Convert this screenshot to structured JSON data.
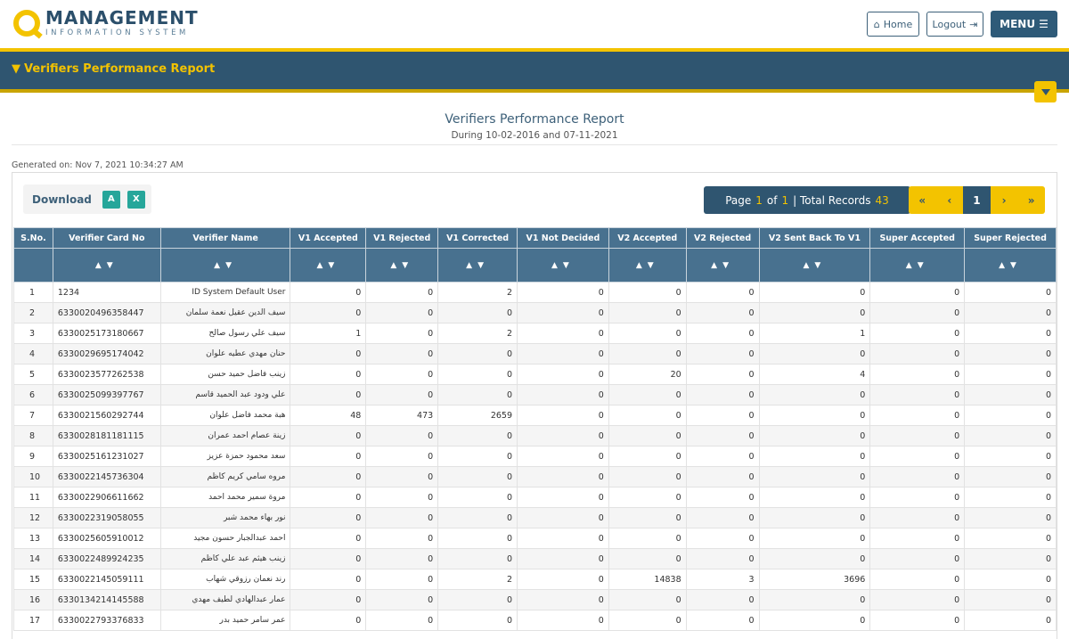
{
  "header": {
    "logo_title": "MANAGEMENT",
    "logo_sub": "INFORMATION SYSTEM",
    "home_label": "Home",
    "logout_label": "Logout",
    "menu_label": "MENU"
  },
  "band": {
    "title": "Verifiers Performance Report"
  },
  "report": {
    "title": "Verifiers Performance Report",
    "subtitle": "During 10-02-2016 and 07-11-2021",
    "generated": "Generated on: Nov 7, 2021 10:34:27 AM"
  },
  "toolbar": {
    "download_label": "Download",
    "pdf_icon_text": "A",
    "excel_icon_text": "X"
  },
  "pagination": {
    "page_label": "Page",
    "current": "1",
    "of_label": "of",
    "total_pages": "1",
    "records_label": "| Total Records",
    "total_records": "43",
    "first": "«",
    "prev": "‹",
    "page_button": "1",
    "next": "›",
    "last": "»"
  },
  "table": {
    "columns": [
      "S.No.",
      "Verifier Card No",
      "Verifier Name",
      "V1 Accepted",
      "V1 Rejected",
      "V1 Corrected",
      "V1 Not Decided",
      "V2 Accepted",
      "V2 Rejected",
      "V2 Sent Back To V1",
      "Super Accepted",
      "Super Rejected"
    ],
    "sort_glyph": "▲▼",
    "rows": [
      [
        "1",
        "1234",
        "ID System Default User",
        "0",
        "0",
        "2",
        "0",
        "0",
        "0",
        "0",
        "0",
        "0"
      ],
      [
        "2",
        "6330020496358447",
        "سيف الدين عقيل نعمة سلمان",
        "0",
        "0",
        "0",
        "0",
        "0",
        "0",
        "0",
        "0",
        "0"
      ],
      [
        "3",
        "6330025173180667",
        "سيف علي رسول صالح",
        "1",
        "0",
        "2",
        "0",
        "0",
        "0",
        "1",
        "0",
        "0"
      ],
      [
        "4",
        "6330029695174042",
        "حنان مهدي عطيه علوان",
        "0",
        "0",
        "0",
        "0",
        "0",
        "0",
        "0",
        "0",
        "0"
      ],
      [
        "5",
        "6330023577262538",
        "زينب فاضل حميد حسن",
        "0",
        "0",
        "0",
        "0",
        "20",
        "0",
        "4",
        "0",
        "0"
      ],
      [
        "6",
        "6330025099397767",
        "علي ودود عبد الحميد قاسم",
        "0",
        "0",
        "0",
        "0",
        "0",
        "0",
        "0",
        "0",
        "0"
      ],
      [
        "7",
        "6330021560292744",
        "هبة محمد فاضل علوان",
        "48",
        "473",
        "2659",
        "0",
        "0",
        "0",
        "0",
        "0",
        "0"
      ],
      [
        "8",
        "6330028181181115",
        "زينة عصام احمد عمران",
        "0",
        "0",
        "0",
        "0",
        "0",
        "0",
        "0",
        "0",
        "0"
      ],
      [
        "9",
        "6330025161231027",
        "سعد محمود حمزة عزيز",
        "0",
        "0",
        "0",
        "0",
        "0",
        "0",
        "0",
        "0",
        "0"
      ],
      [
        "10",
        "6330022145736304",
        "مروه سامي كريم كاظم",
        "0",
        "0",
        "0",
        "0",
        "0",
        "0",
        "0",
        "0",
        "0"
      ],
      [
        "11",
        "6330022906611662",
        "مروة سمير محمد احمد",
        "0",
        "0",
        "0",
        "0",
        "0",
        "0",
        "0",
        "0",
        "0"
      ],
      [
        "12",
        "6330022319058055",
        "نور بهاء محمد شبر",
        "0",
        "0",
        "0",
        "0",
        "0",
        "0",
        "0",
        "0",
        "0"
      ],
      [
        "13",
        "6330025605910012",
        "احمد عبدالجبار حسون مجيد",
        "0",
        "0",
        "0",
        "0",
        "0",
        "0",
        "0",
        "0",
        "0"
      ],
      [
        "14",
        "6330022489924235",
        "زينب هيثم عبد علي كاظم",
        "0",
        "0",
        "0",
        "0",
        "0",
        "0",
        "0",
        "0",
        "0"
      ],
      [
        "15",
        "6330022145059111",
        "رند نعمان رزوقي شهاب",
        "0",
        "0",
        "2",
        "0",
        "14838",
        "3",
        "3696",
        "0",
        "0"
      ],
      [
        "16",
        "6330134214145588",
        "عمار عبدالهادي لطيف مهدي",
        "0",
        "0",
        "0",
        "0",
        "0",
        "0",
        "0",
        "0",
        "0"
      ],
      [
        "17",
        "6330022793376833",
        "عمر سامر حميد بدر",
        "0",
        "0",
        "0",
        "0",
        "0",
        "0",
        "0",
        "0",
        "0"
      ]
    ]
  },
  "colors": {
    "primary": "#2f5570",
    "accent": "#f3c300",
    "header_cell": "#48718f",
    "download_icon": "#26a69a"
  }
}
